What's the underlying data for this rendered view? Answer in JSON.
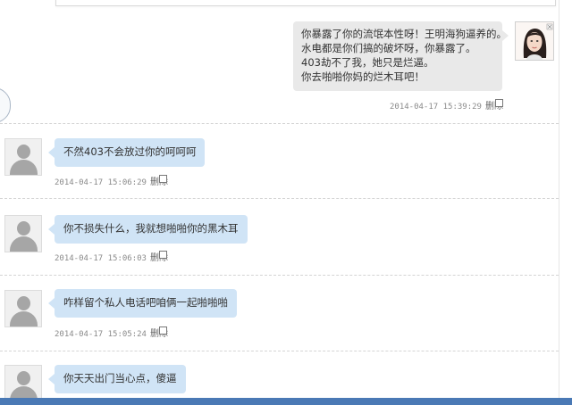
{
  "messages": [
    {
      "side": "right",
      "lines": [
        "你暴露了你的流氓本性呀！王明海狗逼养的。",
        "水电都是你们搞的破坏呀，你暴露了。",
        "403劫不了我，她只是烂逼。",
        "你去啪啪你妈的烂木耳吧！"
      ],
      "timestamp": "2014-04-17 15:39:29",
      "delete_label": "删除"
    },
    {
      "side": "left",
      "text": "不然403不会放过你的呵呵呵",
      "timestamp": "2014-04-17 15:06:29",
      "delete_label": "删除"
    },
    {
      "side": "left",
      "text": "你不损失什么，我就想啪啪你的黑木耳",
      "timestamp": "2014-04-17 15:06:03",
      "delete_label": "删除"
    },
    {
      "side": "left",
      "text": "咋样留个私人电话吧咱俩一起啪啪啪",
      "timestamp": "2014-04-17 15:05:24",
      "delete_label": "删除"
    },
    {
      "side": "left",
      "text": "你天天出门当心点，傻逼"
    }
  ],
  "colors": {
    "left_bubble": "#d0e4f6",
    "right_bubble": "#e9e9e9",
    "bottom_bar": "#4a79b5"
  }
}
